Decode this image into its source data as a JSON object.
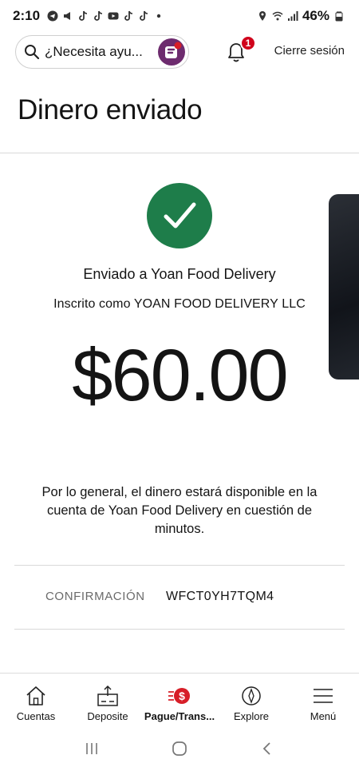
{
  "status_bar": {
    "time": "2:10",
    "battery": "46%"
  },
  "header": {
    "search_placeholder": "¿Necesita ayu...",
    "notification_count": "1",
    "signout_label": "Cierre sesión"
  },
  "page": {
    "title": "Dinero enviado"
  },
  "confirmation": {
    "sent_to": "Enviado a Yoan Food Delivery",
    "enrolled_as": "Inscrito como YOAN FOOD DELIVERY LLC",
    "amount": "$60.00",
    "availability_note": "Por lo general, el dinero estará disponible en la cuenta de Yoan Food Delivery en cuestión de minutos.",
    "label": "CONFIRMACIÓN",
    "code": "WFCT0YH7TQM4"
  },
  "bottom_nav": {
    "items": [
      {
        "label": "Cuentas",
        "icon": "house-icon"
      },
      {
        "label": "Deposite",
        "icon": "deposit-icon"
      },
      {
        "label": "Pague/Trans...",
        "icon": "pay-transfer-icon"
      },
      {
        "label": "Explore",
        "icon": "compass-icon"
      },
      {
        "label": "Menú",
        "icon": "menu-icon"
      }
    ],
    "active_index": 2
  },
  "colors": {
    "success": "#1e7d4a",
    "badge": "#d0021b",
    "brand_red": "#d71e28",
    "assistant": "#6d2b6e"
  }
}
